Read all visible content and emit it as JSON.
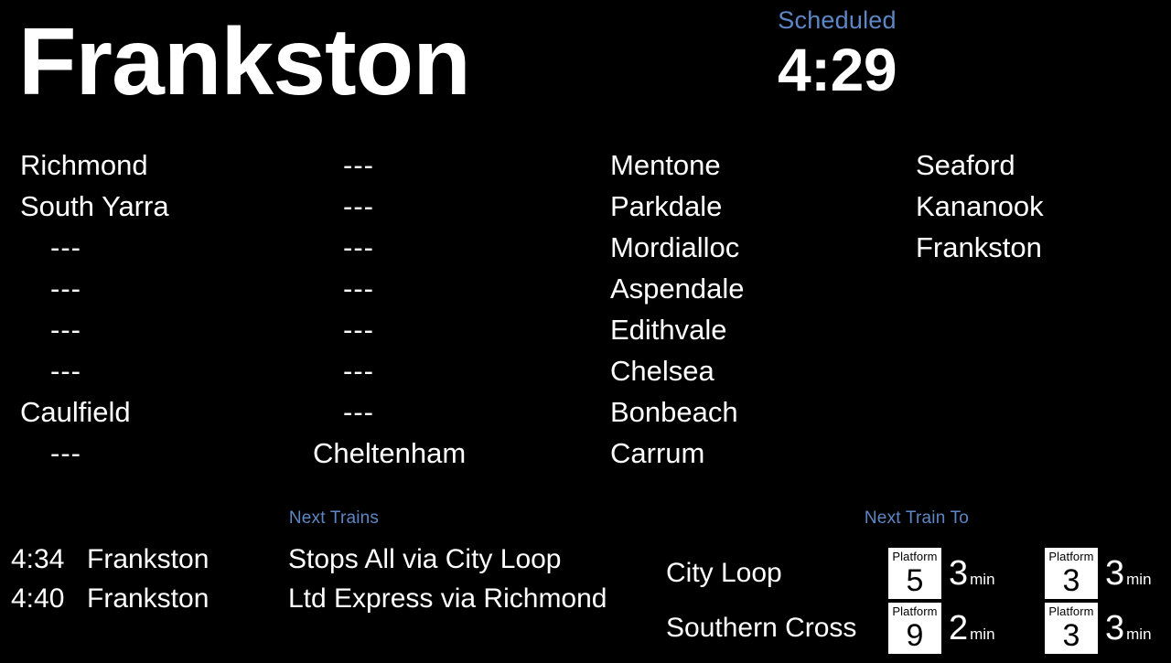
{
  "header": {
    "station_title": "Frankston",
    "scheduled_label": "Scheduled",
    "scheduled_time": "4:29"
  },
  "colors": {
    "background": "#000000",
    "text": "#ffffff",
    "accent_blue": "#5d87c4",
    "badge_background": "#ffffff",
    "badge_text": "#000000"
  },
  "stopping_pattern": {
    "placeholder": "---",
    "columns": [
      {
        "index": 0,
        "cells": [
          "Richmond",
          "South Yarra",
          "---",
          "---",
          "---",
          "---",
          "Caulfield",
          "---"
        ]
      },
      {
        "index": 1,
        "cells": [
          "---",
          "---",
          "---",
          "---",
          "---",
          "---",
          "---",
          "Cheltenham"
        ]
      },
      {
        "index": 2,
        "cells": [
          "Mentone",
          "Parkdale",
          "Mordialloc",
          "Aspendale",
          "Edithvale",
          "Chelsea",
          "Bonbeach",
          "Carrum"
        ]
      },
      {
        "index": 3,
        "cells": [
          "Seaford",
          "Kananook",
          "Frankston",
          "",
          "",
          "",
          "",
          ""
        ]
      }
    ]
  },
  "next_trains": {
    "label": "Next Trains",
    "rows": [
      {
        "time": "4:34",
        "destination": "Frankston",
        "description": "Stops All via City Loop"
      },
      {
        "time": "4:40",
        "destination": "Frankston",
        "description": "Ltd Express via Richmond"
      }
    ]
  },
  "next_train_to": {
    "label": "Next Train To",
    "platform_word": "Platform",
    "minutes_unit": "min",
    "rows": [
      {
        "destination": "City Loop",
        "entries": [
          {
            "platform": "5",
            "minutes": "3"
          },
          {
            "platform": "3",
            "minutes": "3"
          }
        ]
      },
      {
        "destination": "Southern Cross",
        "entries": [
          {
            "platform": "9",
            "minutes": "2"
          },
          {
            "platform": "3",
            "minutes": "3"
          }
        ]
      }
    ]
  }
}
